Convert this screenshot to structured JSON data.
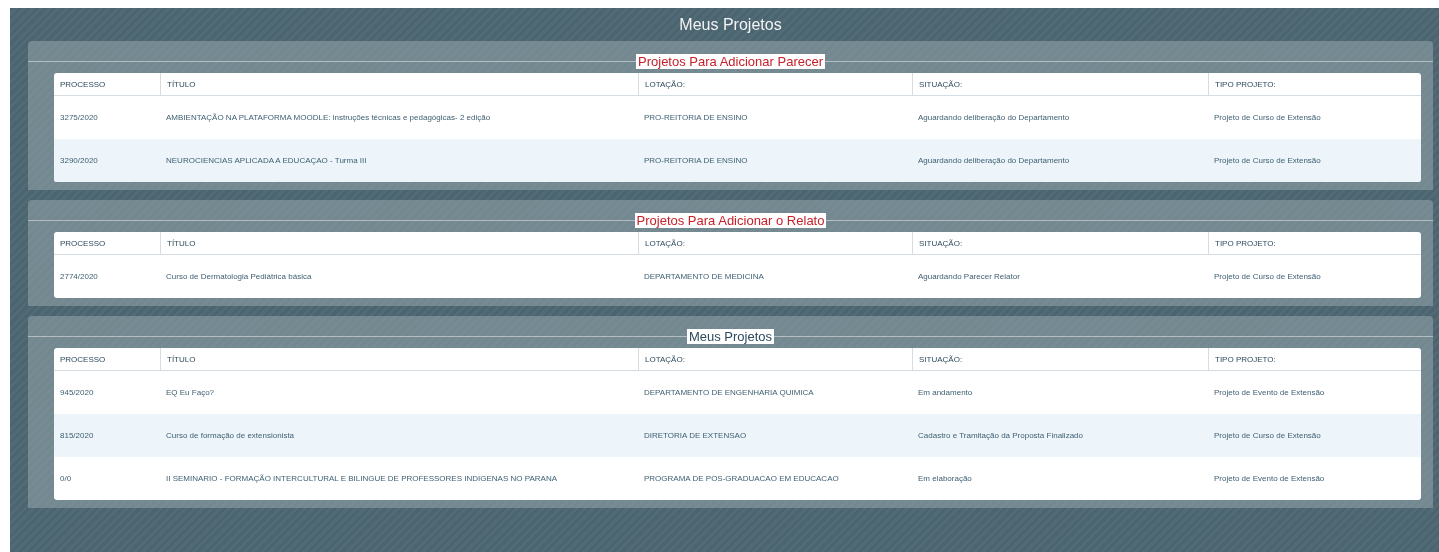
{
  "window": {
    "title": "Meus Projetos"
  },
  "sections": [
    {
      "title": "Projetos Para Adicionar Parecer",
      "kind": "alert",
      "columns": [
        "PROCESSO",
        "TÍTULO",
        "LOTAÇÃO:",
        "SITUAÇÃO:",
        "TIPO PROJETO:"
      ],
      "rows": [
        [
          "3275/2020",
          "AMBIENTAÇÃO NA PLATAFORMA MOODLE: instruções técnicas e pedagógicas- 2 edição",
          "PRO-REITORIA DE ENSINO",
          "Aguardando deliberação do Departamento",
          "Projeto de Curso de Extensão"
        ],
        [
          "3290/2020",
          "NEUROCIENCIAS APLICADA A EDUCAÇAO - Turma III",
          "PRO-REITORIA DE ENSINO",
          "Aguardando deliberação do Departamento",
          "Projeto de Curso de Extensão"
        ]
      ]
    },
    {
      "title": "Projetos Para Adicionar o Relato",
      "kind": "alert",
      "columns": [
        "PROCESSO",
        "TÍTULO",
        "LOTAÇÃO:",
        "SITUAÇÃO:",
        "TIPO PROJETO:"
      ],
      "rows": [
        [
          "2774/2020",
          "Curso de Dermatologia Pediátrica básica",
          "DEPARTAMENTO DE MEDICINA",
          "Aguardando Parecer Relator",
          "Projeto de Curso de Extensão"
        ]
      ]
    },
    {
      "title": "Meus Projetos",
      "kind": "normal",
      "columns": [
        "PROCESSO",
        "TÍTULO",
        "LOTAÇÃO:",
        "SITUAÇÃO:",
        "TIPO PROJETO:"
      ],
      "rows": [
        [
          "945/2020",
          "EQ Eu Faço?",
          "DEPARTAMENTO DE ENGENHARIA QUIMICA",
          "Em andamento",
          "Projeto de Evento de Extensão"
        ],
        [
          "815/2020",
          "Curso de formação de extensionista",
          "DIRETORIA DE EXTENSAO",
          "Cadastro e Tramitação da Proposta Finalizado",
          "Projeto de Curso de Extensão"
        ],
        [
          "0/0",
          "II SEMINARIO - FORMAÇÃO INTERCULTURAL E BILINGUE DE PROFESSORES INDIGENAS NO PARANA",
          "PROGRAMA DE POS-GRADUACAO EM EDUCACAO",
          "Em elaboração",
          "Projeto de Evento de Extensão"
        ]
      ]
    }
  ]
}
